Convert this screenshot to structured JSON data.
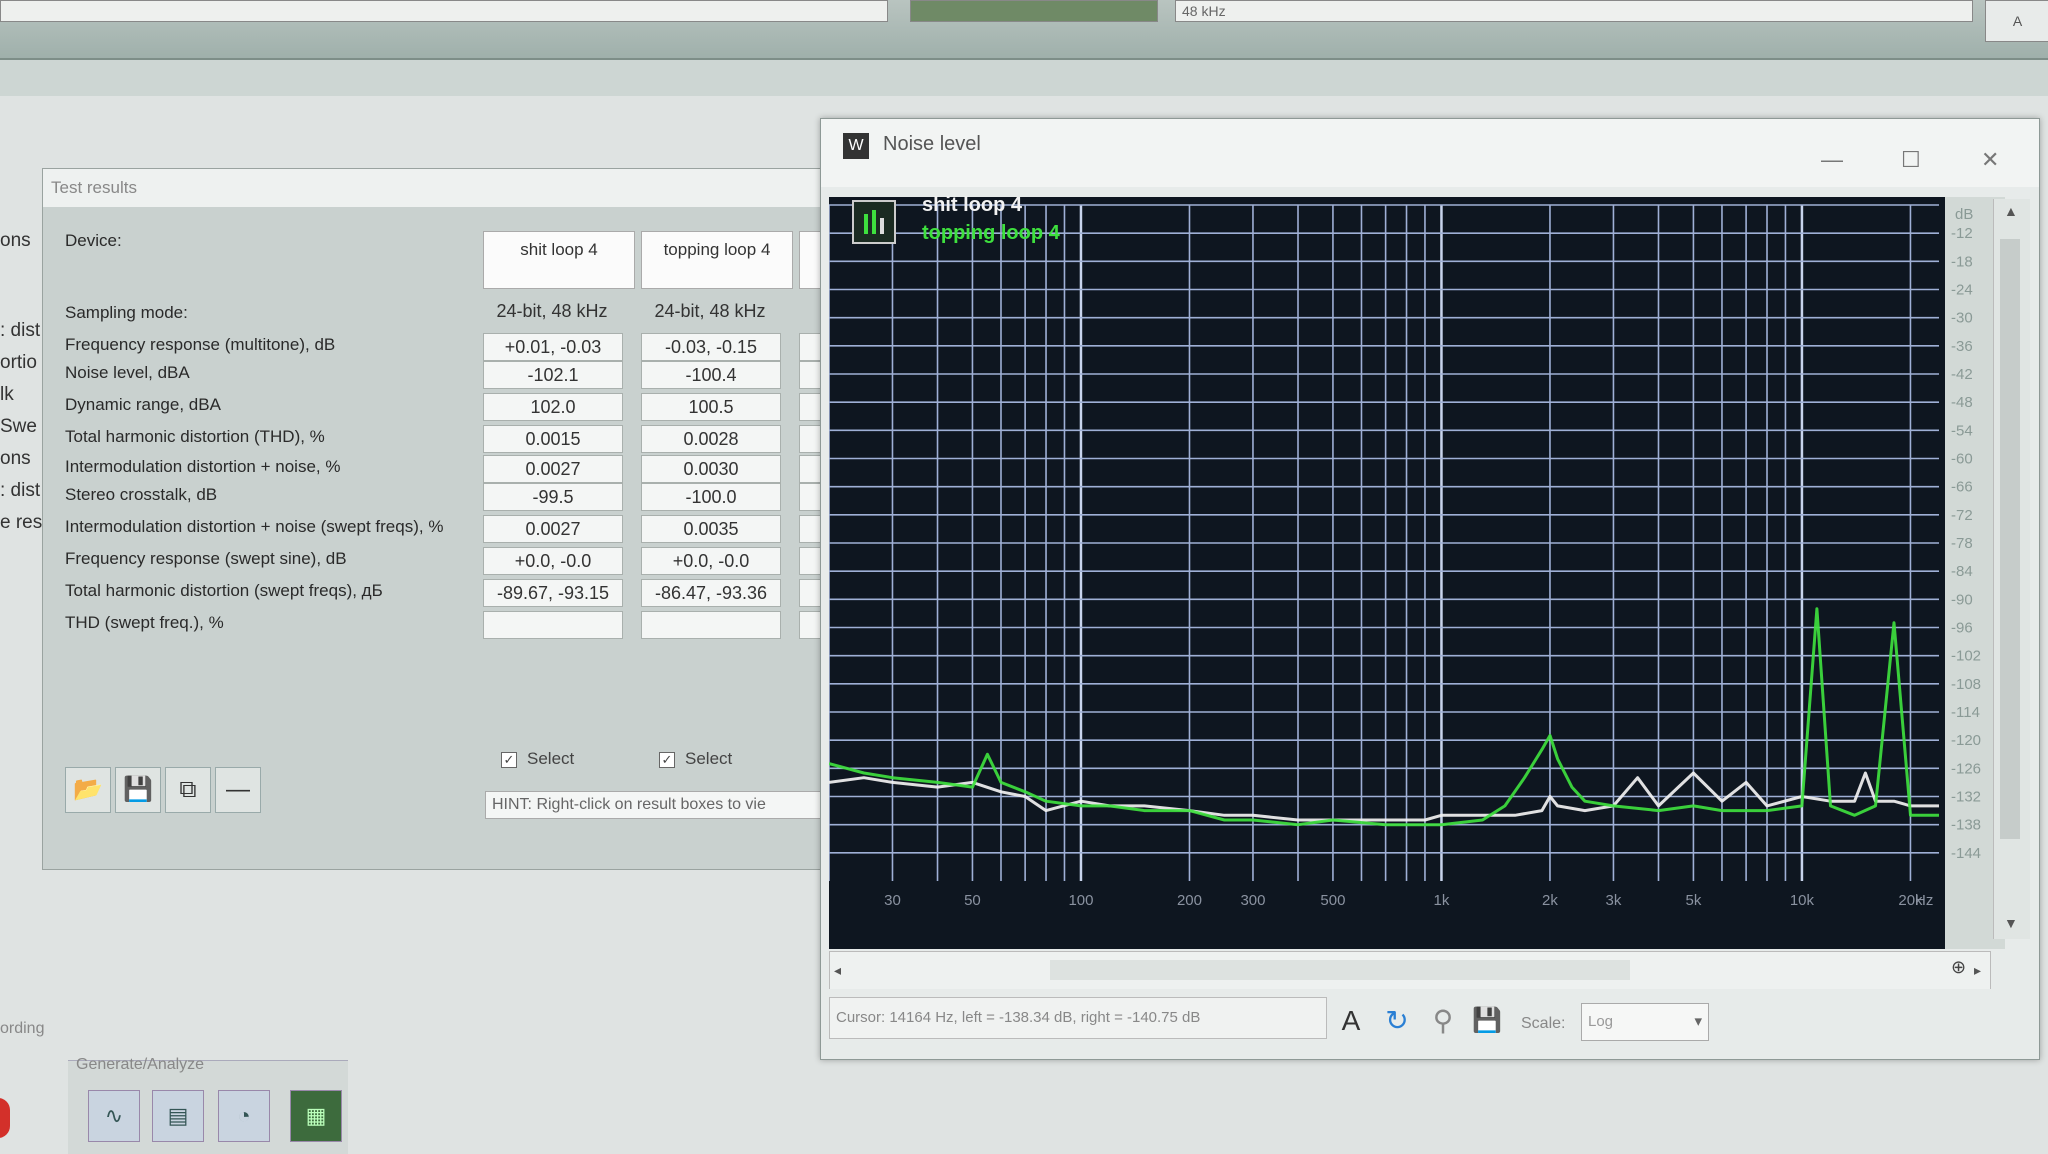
{
  "topbar": {
    "sample_rate": "48 kHz",
    "right_button": "A"
  },
  "left_panel_cut": [
    "ons",
    ": dist",
    "ortio",
    "lk",
    "Swe",
    "ons",
    ": dist",
    "e resi"
  ],
  "test_results": {
    "title": "Test results",
    "device_label": "Device:",
    "devices": [
      "shit loop 4",
      "topping loop 4"
    ],
    "rows": [
      {
        "label": "Sampling mode:",
        "values": [
          "24-bit, 48 kHz",
          "24-bit, 48 kHz"
        ],
        "boxed": false
      },
      {
        "label": "Frequency response (multitone), dB",
        "values": [
          "+0.01, -0.03",
          "-0.03, -0.15"
        ],
        "boxed": true
      },
      {
        "label": "Noise level, dBA",
        "values": [
          "-102.1",
          "-100.4"
        ],
        "boxed": true
      },
      {
        "label": "Dynamic range, dBA",
        "values": [
          "102.0",
          "100.5"
        ],
        "boxed": true
      },
      {
        "label": "Total harmonic distortion (THD), %",
        "values": [
          "0.0015",
          "0.0028"
        ],
        "boxed": true
      },
      {
        "label": "Intermodulation distortion + noise, %",
        "values": [
          "0.0027",
          "0.0030"
        ],
        "boxed": true
      },
      {
        "label": "Stereo crosstalk, dB",
        "values": [
          "-99.5",
          "-100.0"
        ],
        "boxed": true
      },
      {
        "label": "Intermodulation distortion + noise (swept freqs), %",
        "values": [
          "0.0027",
          "0.0035"
        ],
        "boxed": true
      },
      {
        "label": "Frequency response (swept sine), dB",
        "values": [
          "+0.0, -0.0",
          "+0.0, -0.0"
        ],
        "boxed": true
      },
      {
        "label": "Total harmonic distortion (swept freqs), дБ",
        "values": [
          "-89.67, -93.15",
          "-86.47, -93.36"
        ],
        "boxed": true
      },
      {
        "label": "THD (swept freq.), %",
        "values": [
          "",
          ""
        ],
        "boxed": true
      }
    ],
    "select_label": "Select",
    "hint": "HINT: Right-click on result boxes to vie"
  },
  "lower": {
    "recording_label": "ording",
    "generate_label": "Generate/Analyze"
  },
  "noise_window": {
    "title": "Noise level",
    "legend": [
      {
        "name": "shit loop 4",
        "color": "#f2f2f2"
      },
      {
        "name": "topping loop 4",
        "color": "#3ee03e"
      }
    ],
    "y_unit": "dB",
    "y_ticks": [
      "-12",
      "-18",
      "-24",
      "-30",
      "-36",
      "-42",
      "-48",
      "-54",
      "-60",
      "-66",
      "-72",
      "-78",
      "-84",
      "-90",
      "-96",
      "-102",
      "-108",
      "-114",
      "-120",
      "-126",
      "-132",
      "-138",
      "-144"
    ],
    "x_ticks": [
      "30",
      "50",
      "100",
      "200",
      "300",
      "500",
      "1k",
      "2k",
      "3k",
      "5k",
      "10k",
      "20k"
    ],
    "x_unit": "Hz",
    "cursor_text": "Cursor: 14164 Hz, left = -138.34 dB, right = -140.75 dB",
    "scale_label": "Scale:",
    "scale_value": "Log"
  },
  "chart_data": {
    "type": "line",
    "xlabel": "Hz",
    "ylabel": "dB",
    "x_scale": "log",
    "xlim": [
      20,
      24000
    ],
    "ylim": [
      -150,
      -6
    ],
    "grid": true,
    "series": [
      {
        "name": "shit loop 4",
        "color": "#f2f2f2",
        "x": [
          20,
          25,
          30,
          40,
          50,
          60,
          70,
          80,
          100,
          120,
          150,
          200,
          250,
          300,
          400,
          500,
          700,
          800,
          900,
          1000,
          1300,
          1600,
          1900,
          2000,
          2100,
          2500,
          3000,
          3500,
          4000,
          5000,
          6000,
          7000,
          8000,
          10000,
          12000,
          14000,
          15000,
          16000,
          18000,
          20000,
          24000
        ],
        "y": [
          -129,
          -128,
          -129,
          -130,
          -129,
          -131,
          -132,
          -135,
          -133,
          -134,
          -134,
          -135,
          -136,
          -136,
          -137,
          -137,
          -137,
          -137,
          -137,
          -136,
          -136,
          -136,
          -135,
          -132,
          -134,
          -135,
          -134,
          -128,
          -134,
          -127,
          -133,
          -129,
          -134,
          -132,
          -133,
          -133,
          -127,
          -133,
          -133,
          -134,
          -134
        ]
      },
      {
        "name": "topping loop 4",
        "color": "#3ee03e",
        "x": [
          20,
          25,
          30,
          40,
          50,
          55,
          60,
          70,
          80,
          100,
          120,
          150,
          200,
          250,
          300,
          400,
          500,
          700,
          1000,
          1300,
          1500,
          1700,
          1900,
          2000,
          2100,
          2300,
          2500,
          3000,
          4000,
          5000,
          6000,
          8000,
          10000,
          11000,
          12000,
          14000,
          16000,
          18000,
          20000,
          24000
        ],
        "y": [
          -125,
          -127,
          -128,
          -129,
          -130,
          -123,
          -129,
          -131,
          -133,
          -134,
          -134,
          -135,
          -135,
          -137,
          -137,
          -138,
          -137,
          -138,
          -138,
          -137,
          -134,
          -128,
          -122,
          -119,
          -124,
          -130,
          -133,
          -134,
          -135,
          -134,
          -135,
          -135,
          -134,
          -92,
          -134,
          -136,
          -134,
          -95,
          -136,
          -136
        ]
      }
    ]
  }
}
